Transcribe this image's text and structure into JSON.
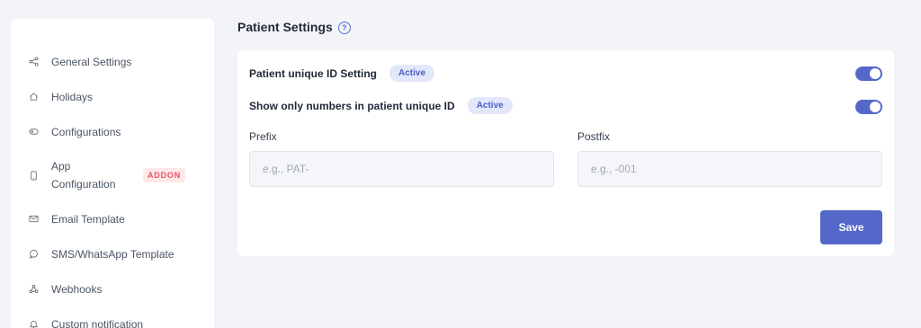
{
  "sidebar": {
    "items": [
      {
        "label": "General Settings",
        "icon": "share-nodes-icon"
      },
      {
        "label": "Holidays",
        "icon": "home-icon"
      },
      {
        "label": "Configurations",
        "icon": "tag-icon"
      },
      {
        "label": "App Configuration",
        "icon": "mobile-icon",
        "badge": "ADDON"
      },
      {
        "label": "Email Template",
        "icon": "envelope-icon"
      },
      {
        "label": "SMS/WhatsApp Template",
        "icon": "chat-bubble-icon"
      },
      {
        "label": "Webhooks",
        "icon": "webhook-icon"
      },
      {
        "label": "Custom notification",
        "icon": "bell-icon"
      }
    ]
  },
  "page": {
    "title": "Patient Settings",
    "help_icon_glyph": "?"
  },
  "settings": {
    "unique_id": {
      "label": "Patient unique ID Setting",
      "status": "Active",
      "enabled": true
    },
    "numbers_only": {
      "label": "Show only numbers in patient unique ID",
      "status": "Active",
      "enabled": true
    }
  },
  "fields": {
    "prefix": {
      "label": "Prefix",
      "value": "",
      "placeholder": "e.g., PAT-"
    },
    "postfix": {
      "label": "Postfix",
      "value": "",
      "placeholder": "e.g., -001"
    }
  },
  "actions": {
    "save_label": "Save"
  },
  "colors": {
    "accent": "#5468c9",
    "badge_bg": "#e3e7fa",
    "addon_text": "#ef4f5f",
    "addon_bg": "#fde8ea",
    "page_bg": "#f3f4f8"
  }
}
